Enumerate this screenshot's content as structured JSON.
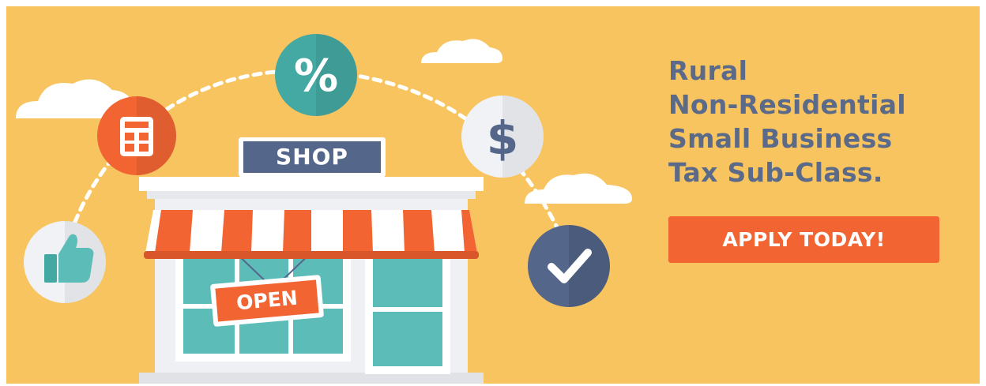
{
  "colors": {
    "background": "#f8c45f",
    "title_text": "#5a6a88",
    "cta_background": "#f26533",
    "shop_sign": "#54668a",
    "awning_red": "#f26533",
    "awning_white": "#ffffff",
    "glass": "#5cbdb8",
    "percent_circle": "#44a9a2",
    "calculator_circle": "#f26533",
    "check_circle": "#54668a"
  },
  "shop": {
    "sign_label": "SHOP",
    "open_label": "OPEN"
  },
  "icons": [
    "calculator-icon",
    "percent-icon",
    "dollar-icon",
    "thumbs-up-icon",
    "checkmark-icon",
    "cloud-icon"
  ],
  "headline": {
    "lines": [
      "Rural",
      "Non-Residential",
      "Small Business",
      "Tax Sub-Class."
    ]
  },
  "cta": {
    "label": "APPLY TODAY!"
  }
}
